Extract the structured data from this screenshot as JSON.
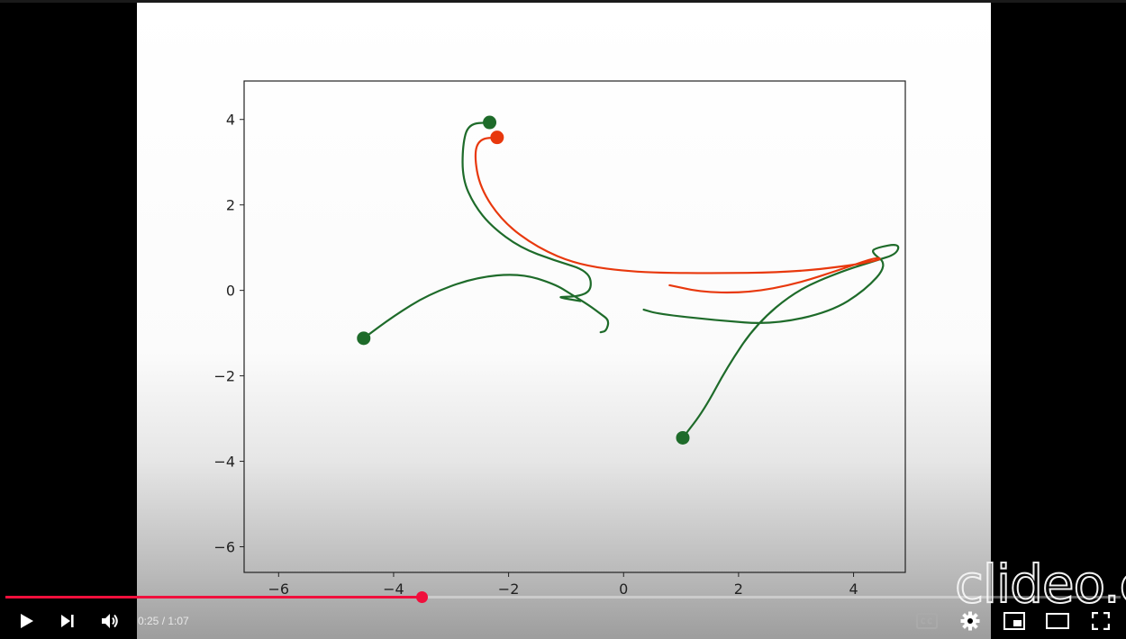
{
  "video": {
    "watermark": "clideo.com",
    "chart_data": {
      "type": "line",
      "title": "",
      "xlabel": "",
      "ylabel": "",
      "xlim": [
        -6.6,
        4.9
      ],
      "ylim": [
        -6.6,
        4.9
      ],
      "xticks": [
        -6,
        -4,
        -2,
        0,
        2,
        4
      ],
      "yticks": [
        -6,
        -4,
        -2,
        0,
        2,
        4
      ],
      "grid": false,
      "series": [
        {
          "color": "#1e6b2a",
          "values": [
            [
              -4.52,
              -1.12
            ],
            [
              -4.0,
              -0.6
            ],
            [
              -3.4,
              -0.1
            ],
            [
              -2.6,
              0.3
            ],
            [
              -1.8,
              0.4
            ],
            [
              -1.2,
              0.15
            ],
            [
              -0.9,
              -0.1
            ],
            [
              -0.6,
              -0.35
            ],
            [
              -0.4,
              -0.55
            ],
            [
              -0.25,
              -0.7
            ],
            [
              -0.3,
              -0.95
            ],
            [
              -0.4,
              -0.98
            ]
          ],
          "marker_start": true
        },
        {
          "color": "#1e6b2a",
          "values": [
            [
              -2.33,
              3.93
            ],
            [
              -2.7,
              3.9
            ],
            [
              -2.8,
              3.4
            ],
            [
              -2.8,
              2.6
            ],
            [
              -2.6,
              2.0
            ],
            [
              -2.3,
              1.5
            ],
            [
              -1.8,
              1.0
            ],
            [
              -1.2,
              0.7
            ],
            [
              -0.6,
              0.45
            ],
            [
              -0.55,
              0.0
            ],
            [
              -0.8,
              -0.15
            ],
            [
              -1.2,
              -0.15
            ],
            [
              -0.75,
              -0.25
            ]
          ],
          "marker_start": true
        },
        {
          "color": "#1e6b2a",
          "values": [
            [
              1.03,
              -3.45
            ],
            [
              1.4,
              -2.8
            ],
            [
              1.8,
              -1.8
            ],
            [
              2.3,
              -0.8
            ],
            [
              3.0,
              0.0
            ],
            [
              3.8,
              0.45
            ],
            [
              4.4,
              0.7
            ],
            [
              4.75,
              0.85
            ],
            [
              4.8,
              1.1
            ],
            [
              4.4,
              1.0
            ],
            [
              4.3,
              0.9
            ],
            [
              4.6,
              0.6
            ],
            [
              4.2,
              0.0
            ],
            [
              3.6,
              -0.5
            ],
            [
              2.6,
              -0.8
            ],
            [
              1.6,
              -0.7
            ],
            [
              0.6,
              -0.55
            ],
            [
              0.35,
              -0.45
            ]
          ],
          "marker_start": true
        },
        {
          "color": "#e8380d",
          "values": [
            [
              -2.2,
              3.58
            ],
            [
              -2.5,
              3.55
            ],
            [
              -2.6,
              3.2
            ],
            [
              -2.5,
              2.4
            ],
            [
              -2.1,
              1.6
            ],
            [
              -1.5,
              1.0
            ],
            [
              -0.8,
              0.6
            ],
            [
              0.2,
              0.42
            ],
            [
              1.5,
              0.4
            ],
            [
              2.8,
              0.42
            ],
            [
              3.8,
              0.55
            ],
            [
              4.5,
              0.72
            ],
            [
              4.4,
              0.78
            ],
            [
              3.8,
              0.5
            ],
            [
              3.0,
              0.15
            ],
            [
              2.2,
              -0.05
            ],
            [
              1.4,
              -0.05
            ],
            [
              0.8,
              0.12
            ]
          ],
          "marker_start": true
        }
      ]
    }
  },
  "controls": {
    "current_time": "0:25",
    "separator": " / ",
    "duration": "1:07",
    "progress_fraction": 0.373,
    "accent_color": "#f00f3c",
    "icons": [
      "play-icon",
      "next-icon",
      "volume-icon",
      "captions-icon",
      "settings-icon",
      "miniplayer-icon",
      "theater-icon",
      "fullscreen-icon"
    ]
  }
}
